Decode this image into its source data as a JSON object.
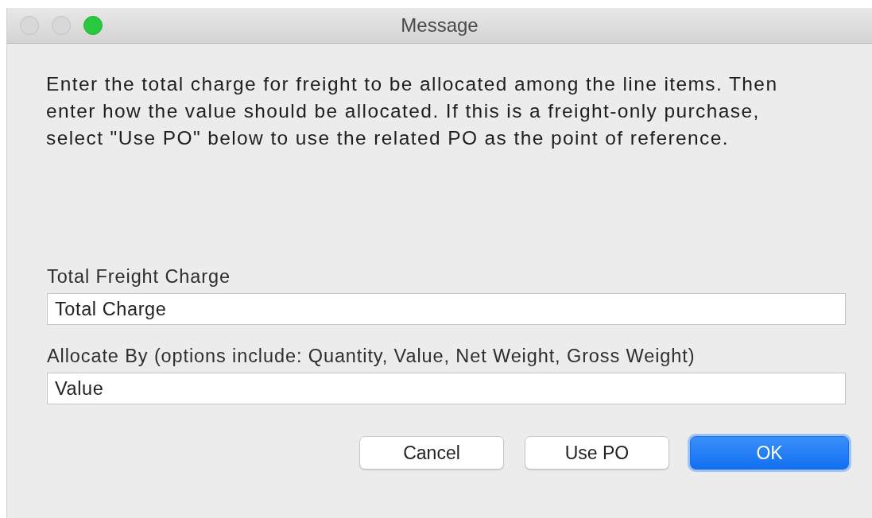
{
  "window": {
    "title": "Message",
    "controls": [
      {
        "kind": "close",
        "active": false
      },
      {
        "kind": "minimize",
        "active": false
      },
      {
        "kind": "zoom",
        "active": true
      }
    ]
  },
  "message": "Enter the total charge for freight to be allocated among the line items. Then enter how the value should be allocated. If this is a freight-only purchase, select \"Use PO\" below to use the related PO as the point of reference.",
  "fields": [
    {
      "label": "Total Freight Charge",
      "value": "Total Charge"
    },
    {
      "label": "Allocate By (options include: Quantity, Value, Net Weight, Gross Weight)",
      "value": "Value"
    }
  ],
  "buttons": [
    {
      "label": "Cancel",
      "default": false
    },
    {
      "label": "Use PO",
      "default": false
    },
    {
      "label": "OK",
      "default": true
    }
  ]
}
